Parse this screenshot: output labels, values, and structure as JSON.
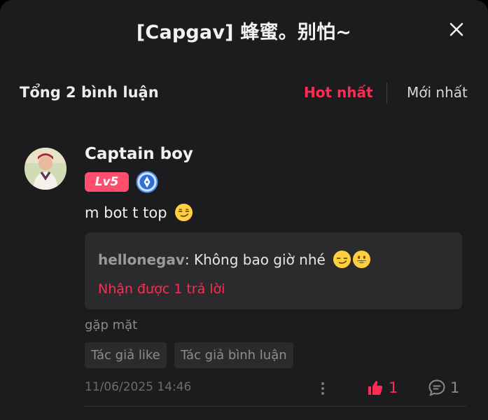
{
  "header": {
    "title": "[Capgav] 蜂蜜。别怕~"
  },
  "comments_summary": {
    "total_label": "Tổng 2 bình luận",
    "sort_hot": "Hot nhất",
    "sort_new": "Mới nhất",
    "active_sort": "hot"
  },
  "comment": {
    "username": "Captain boy",
    "level": "Lv5",
    "text": "m bot t top",
    "text_emoji": "smirk",
    "reply_preview": {
      "username": "hellonegav",
      "text": ": Không bao giờ nhé",
      "emojis": [
        "smirk",
        "grinning"
      ],
      "more_label": "Nhận được 1 trả lời"
    },
    "extra_text": "gặp mặt",
    "tags": [
      "Tác giả like",
      "Tác giả bình luận"
    ],
    "timestamp": "11/06/2025 14:46",
    "like_count": "1",
    "reply_count": "1"
  },
  "colors": {
    "accent": "#fe2c55",
    "background": "#1c1c1e",
    "card": "#2b2b2d",
    "level_badge": "#ff4d6d"
  },
  "icons": {
    "close": "close-icon",
    "more": "more-vertical-icon",
    "like": "thumbs-up-icon",
    "reply": "comment-icon",
    "medal": "fountain-pen-medal-icon"
  }
}
